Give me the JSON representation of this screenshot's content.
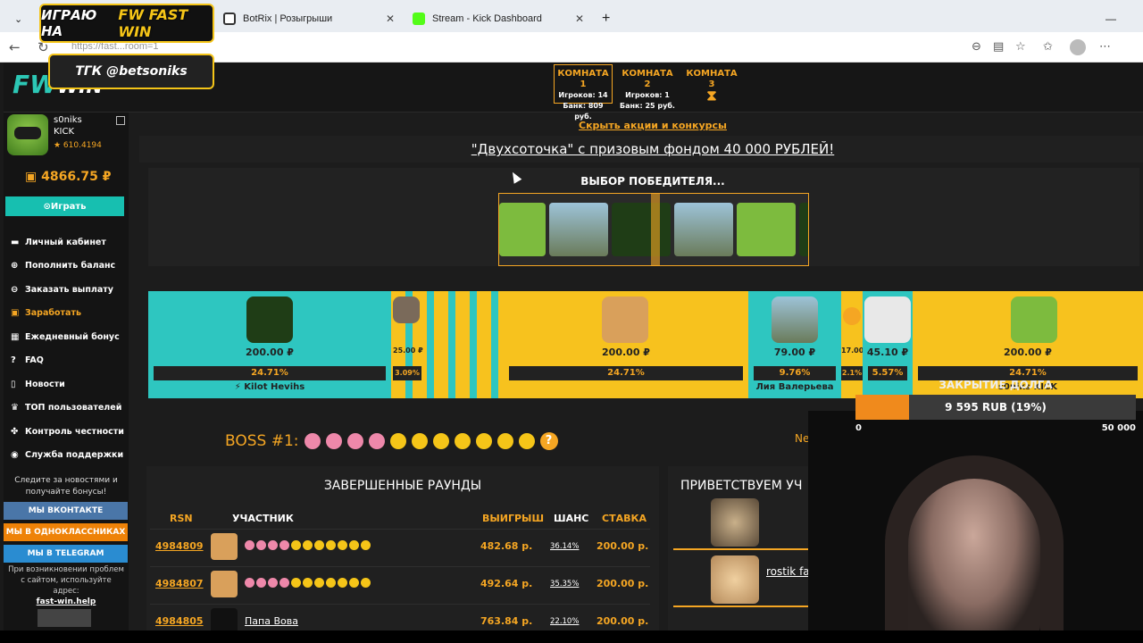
{
  "browser": {
    "tabs": [
      {
        "label": "BotRix | Розыгрыши"
      },
      {
        "label": "Stream - Kick Dashboard"
      }
    ],
    "address": "https://fast...room=1"
  },
  "promo": {
    "line1": "ИГРАЮ НА",
    "brand": "FW FAST WIN",
    "line2": "ТГК @betsoniks"
  },
  "header": {
    "logo_main": "FW",
    "logo_sub": "WIN",
    "rooms": [
      {
        "title": "КОМНАТА 1",
        "players": "Игроков: 14",
        "bank": "Банк: 809 руб."
      },
      {
        "title": "КОМНАТА 2",
        "players": "Игроков: 1",
        "bank": "Банк: 25 руб."
      },
      {
        "title": "КОМНАТА 3",
        "players": "",
        "bank": ""
      }
    ]
  },
  "sidebar": {
    "username": "s0niks",
    "platform": "KICK",
    "rating": "★ 610.4194",
    "balance": "4866.75 ₽",
    "play_label": "Играть",
    "items": [
      {
        "icon": "wallet-icon",
        "label": "Личный кабинет"
      },
      {
        "icon": "plus-circle-icon",
        "label": "Пополнить баланс"
      },
      {
        "icon": "arrow-down-circle-icon",
        "label": "Заказать выплату"
      },
      {
        "icon": "money-icon",
        "label": "Заработать"
      },
      {
        "icon": "gift-icon",
        "label": "Ежедневный бонус"
      },
      {
        "icon": "help-icon",
        "label": "FAQ"
      },
      {
        "icon": "bookmark-icon",
        "label": "Новости"
      },
      {
        "icon": "trophy-icon",
        "label": "ТОП пользователей"
      },
      {
        "icon": "shield-icon",
        "label": "Контроль честности"
      },
      {
        "icon": "support-icon",
        "label": "Служба поддержки"
      }
    ],
    "follow_text": "Следите за новостями и получайте бонусы!",
    "social": [
      "МЫ ВКОНТАКТЕ",
      "МЫ В ОДНОКЛАССНИКАХ",
      "МЫ В TELEGRAM"
    ],
    "help_text": "При возникновении проблем с сайтом, используйте адрес:",
    "help_link": "fast-win.help"
  },
  "main": {
    "hide_link": "Скрыть акции и конкурсы",
    "promo_title": "\"Двухсоточка\" с призовым фондом 40 000 РУБЛЕЙ!",
    "winner_title": "ВЫБОР ПОБЕДИТЕЛЯ...",
    "players": [
      {
        "amount": "200.00 ₽",
        "chance": "24.71%",
        "name": "⚡ Kilot Hevihs"
      },
      {
        "amount": "25.00 ₽",
        "chance": "3.09%",
        "name": ""
      },
      {
        "amount": "200.00 ₽",
        "chance": "24.71%",
        "name": ""
      },
      {
        "amount": "79.00 ₽",
        "chance": "9.76%",
        "name": "Лия Валерьева"
      },
      {
        "amount": "17.00",
        "chance": "2.1%",
        "name": ""
      },
      {
        "amount": "45.10 ₽",
        "chance": "5.57%",
        "name": ""
      },
      {
        "amount": "200.00 ₽",
        "chance": "24.71%",
        "name": "s0niks KICK"
      }
    ],
    "boss_label": "BOSS #1:",
    "ne_text": "Ne",
    "rounds": {
      "title": "ЗАВЕРШЕННЫЕ РАУНДЫ",
      "headers": [
        "RSN",
        "УЧАСТНИК",
        "ВЫИГРЫШ",
        "ШАНС",
        "СТАВКА"
      ],
      "rows": [
        {
          "rsn": "4984809",
          "name": "",
          "win": "482.68 р.",
          "chance": "36.14%",
          "bet": "200.00 р."
        },
        {
          "rsn": "4984807",
          "name": "",
          "win": "492.64 р.",
          "chance": "35.35%",
          "bet": "200.00 р."
        },
        {
          "rsn": "4984805",
          "name": "Папа Вова",
          "win": "763.84 р.",
          "chance": "22.10%",
          "bet": "200.00 р."
        }
      ]
    },
    "welcome": {
      "title": "ПРИВЕТСТВУЕМ УЧ",
      "items": [
        {
          "name": ""
        },
        {
          "name": "rostik faster"
        }
      ]
    }
  },
  "debt": {
    "title": "ЗАКРЫТИЕ ДОЛГА",
    "value": "9 595 RUB (19%)",
    "progress": 0.19,
    "min": "0",
    "max": "50 000"
  },
  "colors": {
    "accent": "#f5a623",
    "teal": "#17bfb0",
    "yellow": "#f7c21e"
  }
}
